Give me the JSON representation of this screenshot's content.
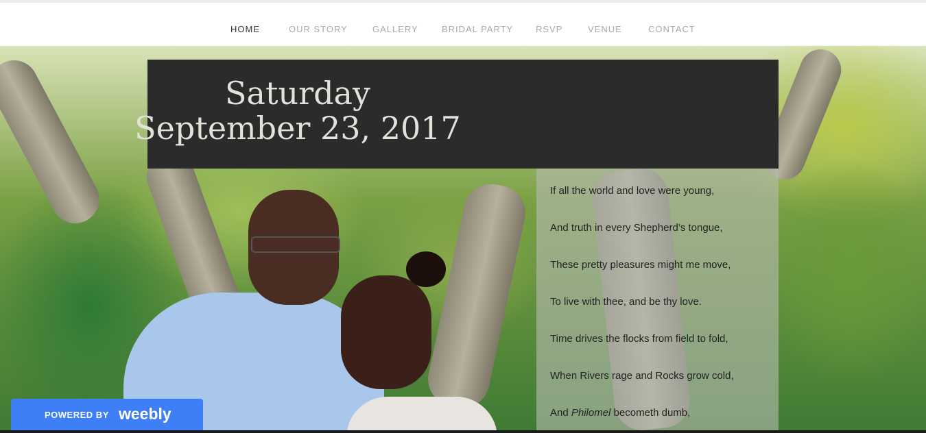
{
  "nav": {
    "items": [
      {
        "label": "HOME",
        "active": true
      },
      {
        "label": "OUR STORY",
        "active": false
      },
      {
        "label": "GALLERY",
        "active": false
      },
      {
        "label": "BRIDAL PARTY",
        "active": false
      },
      {
        "label": "RSVP",
        "active": false
      },
      {
        "label": "VENUE",
        "active": false
      },
      {
        "label": "CONTACT",
        "active": false
      }
    ]
  },
  "date_banner": {
    "day": "Saturday",
    "date": "September 23, 2017"
  },
  "poem": {
    "lines": [
      "If all the world and love were young,",
      "And truth in every Shepherd’s tongue,",
      "These pretty pleasures might me move,",
      "To live with thee, and be thy love.",
      "Time drives the flocks from field to fold,",
      "When Rivers rage and Rocks grow cold,",
      "And Philomel becometh dumb,"
    ],
    "last_line_pre": "And ",
    "last_line_em": "Philomel",
    "last_line_post": " becometh dumb,"
  },
  "badge": {
    "powered_by": "POWERED BY",
    "brand": "weebly"
  },
  "colors": {
    "nav_active": "#333333",
    "nav_inactive": "#a8a8a8",
    "banner_bg": "#2b2b2b",
    "badge_bg": "#3e7ef7"
  }
}
